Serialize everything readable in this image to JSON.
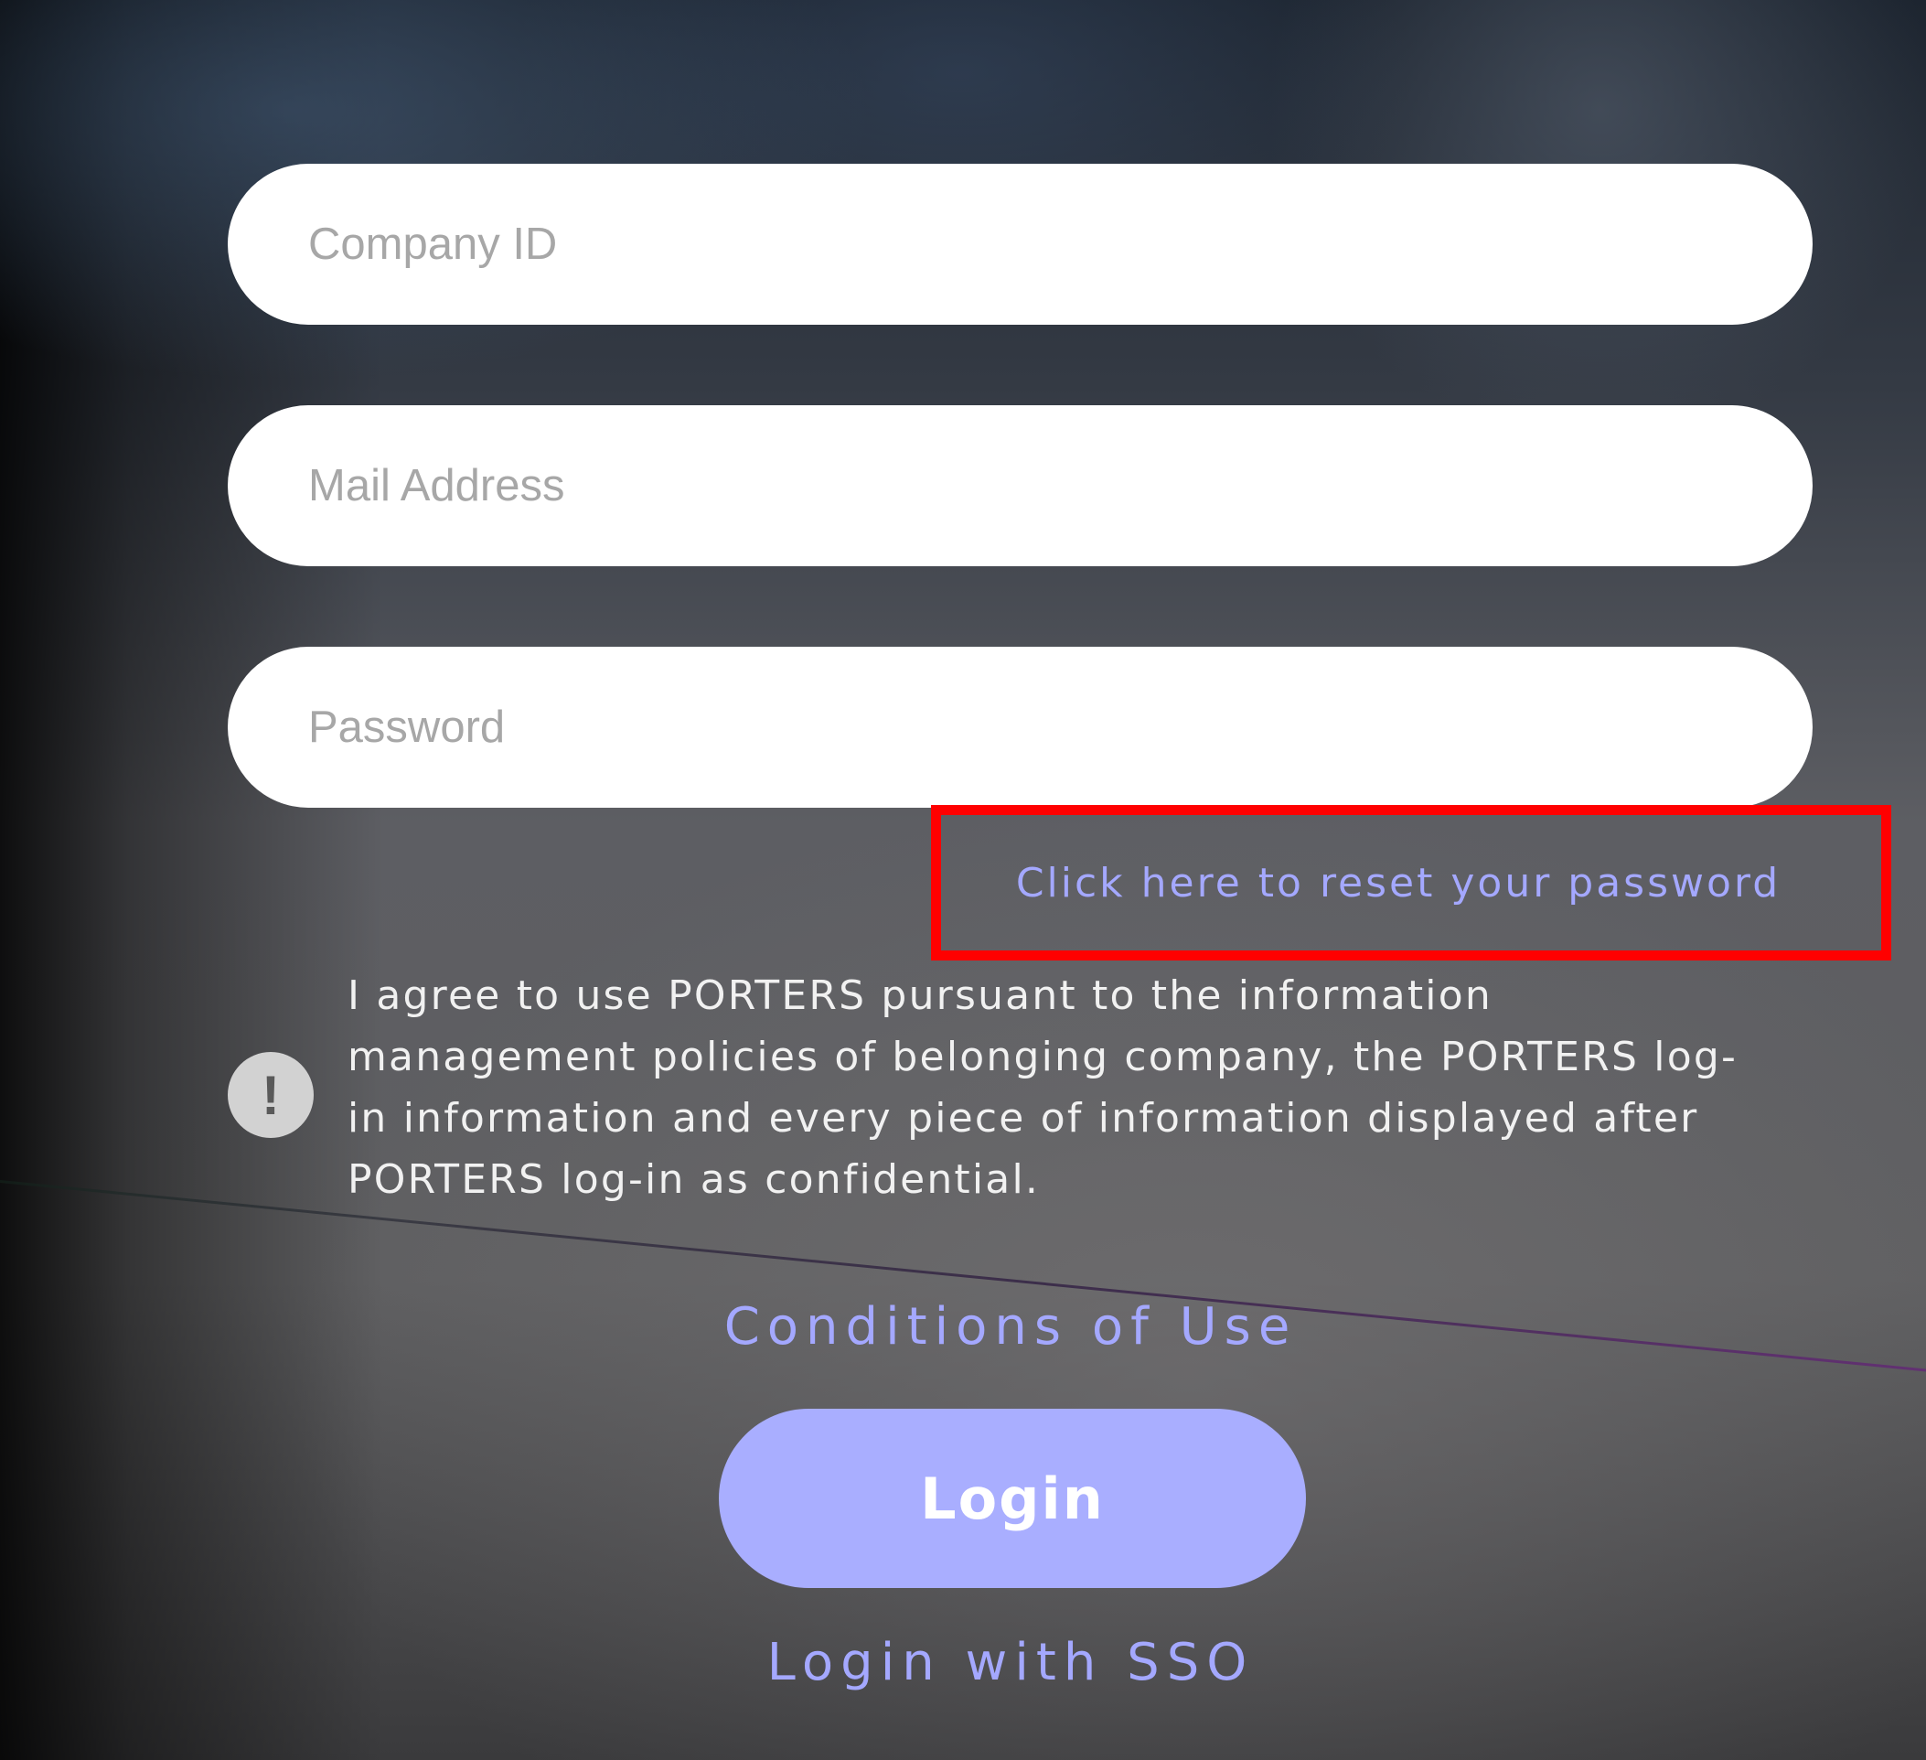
{
  "form": {
    "company_id_placeholder": "Company ID",
    "mail_address_placeholder": "Mail Address",
    "password_placeholder": "Password",
    "company_id_value": "",
    "mail_address_value": "",
    "password_value": ""
  },
  "links": {
    "reset_password": "Click here to reset your password",
    "conditions_of_use": "Conditions of Use",
    "login_with_sso": "Login with SSO"
  },
  "notice": {
    "icon": "exclamation-icon",
    "icon_glyph": "!",
    "text": "I agree to use PORTERS pursuant to the information management policies of belonging company, the PORTERS log-in information and every piece of information displayed after PORTERS log-in as confidential."
  },
  "actions": {
    "login_label": "Login"
  },
  "colors": {
    "link": "#a4a8ff",
    "login_button": "#a9aeff",
    "highlight_box": "#ff0000",
    "field_background": "#ffffff"
  }
}
